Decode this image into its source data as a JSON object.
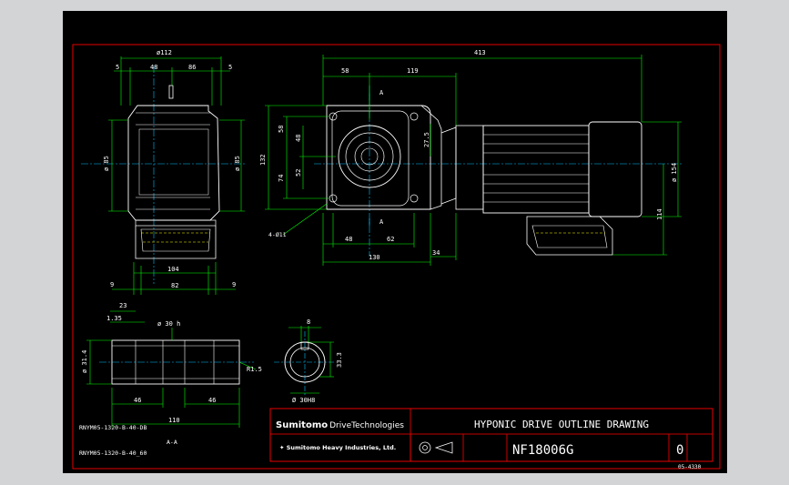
{
  "title_block": {
    "brand": "Sumitomo Drive Technologies",
    "brand_short": "Sumitomo",
    "brand_rest": "DriveTechnologies",
    "company": "Sumitomo Heavy Industries, Ltd.",
    "drawing_title": "HYPONIC DRIVE OUTLINE DRAWING",
    "drawing_number": "NF18006G",
    "revision": "0",
    "sheet_ref": "05-4330"
  },
  "notes": {
    "model_1": "RNYM05-1320-B-40-DB",
    "model_2": "RNYM05-1320-B-40_60",
    "section": "A-A",
    "hole_callout": "4-Ø11",
    "section_mark": "A"
  },
  "side_view": {
    "d_top_width": "ø112",
    "d_5_left": "5",
    "d_48": "48",
    "d_86": "86",
    "d_5_right": "5",
    "d_o85_left": "ø 85",
    "d_o85_right": "ø 85",
    "d_104": "104",
    "d_9_left": "9",
    "d_82": "82",
    "d_9_right": "9"
  },
  "front_view": {
    "d_total": "413",
    "d_58": "58",
    "d_119": "119",
    "d_58_v": "58",
    "d_48_v": "48",
    "d_52_v": "52",
    "d_74_v": "74",
    "d_132_v": "132",
    "d_27_5": "27.5",
    "d_48_h": "48",
    "d_62_h": "62",
    "d_130": "130",
    "d_34": "34",
    "d_o154": "ø 154",
    "d_114": "114"
  },
  "shaft_view": {
    "d_23": "23",
    "d_1_35": "1.35",
    "d_o30": "ø 30 h",
    "d_o31_4": "ø 31.4",
    "d_r1_5": "R1.5",
    "d_46_left": "46",
    "d_46_right": "46",
    "d_110": "110"
  },
  "bore_view": {
    "d_8": "8",
    "d_33_3": "33.3",
    "d_o30h8": "Ø 30H8"
  },
  "colors": {
    "border": "#ff0000",
    "outline": "#ffffff",
    "dimension": "#00ff00",
    "centerline": "#00bfff",
    "hidden": "#ffff00",
    "background": "#000000",
    "frame": "#d2d4d6"
  }
}
